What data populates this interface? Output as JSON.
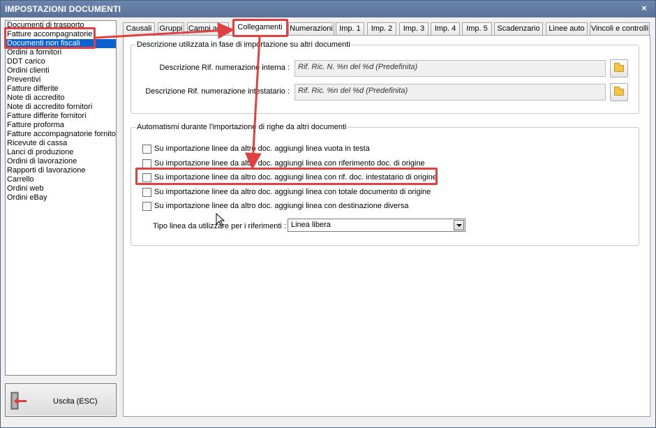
{
  "window": {
    "title": "IMPOSTAZIONI DOCUMENTI",
    "close_glyph": "×"
  },
  "doc_list": {
    "items": [
      "Documenti di trasporto",
      "Fatture accompagnatorie",
      "Documenti non fiscali",
      "Ordini a fornitori",
      "DDT carico",
      "Ordini clienti",
      "Preventivi",
      "Fatture differite",
      "Note di accredito",
      "Note di accredito fornitori",
      "Fatture differite fornitori",
      "Fatture proforma",
      "Fatture accompagnatorie fornito",
      "Ricevute di cassa",
      "Lanci di produzione",
      "Ordini di lavorazione",
      "Rapporti di lavorazione",
      "Carrello",
      "Ordini web",
      "Ordini eBay"
    ],
    "selected_index": 2
  },
  "exit_button": {
    "label": "Uscita (ESC)",
    "icon": "exit-door-icon"
  },
  "tabs": {
    "items": [
      "Causali",
      "Gruppi",
      "Campi agg.",
      "Collegamenti",
      "Numerazioni",
      "Imp. 1",
      "Imp. 2",
      "Imp. 3",
      "Imp. 4",
      "Imp. 5",
      "Scadenzario",
      "Linee auto",
      "Vincoli e controlli"
    ],
    "active_index": 3
  },
  "description_group": {
    "legend": "Descrizione utilizzata in fase di importazione su altri documenti",
    "internal_label": "Descrizione Rif. numerazione interna :",
    "internal_value": "Rif. Ric. N. %n del %d (Predefinita)",
    "holder_label": "Descrizione Rif. numerazione intestatario :",
    "holder_value": "Rif. Ric. %n del %d (Predefinita)",
    "folder_icon": "folder-icon"
  },
  "automation_group": {
    "legend": "Automatismi durante l'importazione di righe da altri documenti",
    "checkboxes": [
      {
        "label": "Su importazione linee da altro doc. aggiungi linea vuota in testa",
        "checked": false
      },
      {
        "label": "Su importazione linee da altro doc. aggiungi linea con riferimento doc. di origine",
        "checked": false
      },
      {
        "label": "Su importazione linee da altro doc. aggiungi linea con rif. doc. intestatario di origine",
        "checked": false
      },
      {
        "label": "Su importazione linee da altro doc. aggiungi linea con totale documento di origine",
        "checked": false
      },
      {
        "label": "Su importazione linee da altro doc. aggiungi linea con destinazione diversa",
        "checked": false
      }
    ],
    "line_type_label": "Tipo linea da utilizzare per i riferimenti :",
    "line_type_value": "Linea libera"
  },
  "annotation_color": "#e04040"
}
